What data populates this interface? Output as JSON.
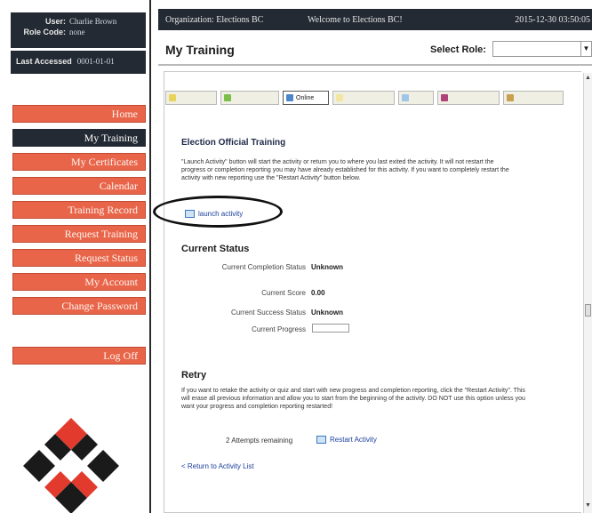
{
  "sidebar": {
    "user_label": "User:",
    "user_value": "Charlie Brown",
    "role_label": "Role Code:",
    "role_value": "none",
    "last_accessed_label": "Last Accessed",
    "last_accessed_value": "0001-01-01",
    "nav": [
      {
        "label": "Home",
        "active": false
      },
      {
        "label": "My Training",
        "active": true
      },
      {
        "label": "My Certificates",
        "active": false
      },
      {
        "label": "Calendar",
        "active": false
      },
      {
        "label": "Training Record",
        "active": false
      },
      {
        "label": "Request Training",
        "active": false
      },
      {
        "label": "Request Status",
        "active": false
      },
      {
        "label": "My Account",
        "active": false
      },
      {
        "label": "Change Password",
        "active": false
      }
    ],
    "logoff": "Log Off",
    "logo_icon": "elections-bc-logo-icon"
  },
  "topbar": {
    "organization": "Organization: Elections BC",
    "welcome": "Welcome to Elections BC!",
    "timestamp": "2015-12-30 03:50:05"
  },
  "header": {
    "title": "My Training",
    "select_role_label": "Select Role:",
    "select_role_value": ""
  },
  "tabs": [
    {
      "label": "",
      "icon": "doc-icon",
      "color": "#e8d45a"
    },
    {
      "label": "",
      "icon": "flag-icon",
      "color": "#7bbf4a"
    },
    {
      "label": "Online",
      "icon": "monitor-icon",
      "color": "#4a86c8",
      "active": true
    },
    {
      "label": "",
      "icon": "star-icon",
      "color": "#f2e6a0"
    },
    {
      "label": "",
      "icon": "chart-icon",
      "color": "#9fc6ea"
    },
    {
      "label": "",
      "icon": "gift-icon",
      "color": "#b0407a"
    },
    {
      "label": "",
      "icon": "box-icon",
      "color": "#c8a050"
    }
  ],
  "training": {
    "section_title": "Election Official Training",
    "description": "\"Launch Activity\" button will start the activity or return you to where you last exited the activity. It will not restart the progress or completion reporting you may have already established for this activity. If you want to completely restart the activity with new reporting use the \"Restart Activity\" button below.",
    "launch_label": "launch activity"
  },
  "status": {
    "section_title": "Current Status",
    "rows": [
      {
        "key": "Current Completion Status",
        "value": "Unknown"
      },
      {
        "key": "Current Score",
        "value": "0.00"
      },
      {
        "key": "Current Success Status",
        "value": "Unknown"
      },
      {
        "key": "Current Progress",
        "value": ""
      }
    ]
  },
  "retry": {
    "section_title": "Retry",
    "description": "If you want to retake the activity or quiz and start with new progress and completion reporting, click the \"Restart Activity\". This will erase all previous information and allow you to start from the beginning of the activity. DO NOT use this option unless you want your progress and completion reporting restarted!",
    "attempts": "2 Attempts remaining",
    "restart_label": "Restart Activity",
    "return_link": "< Return to Activity List"
  }
}
